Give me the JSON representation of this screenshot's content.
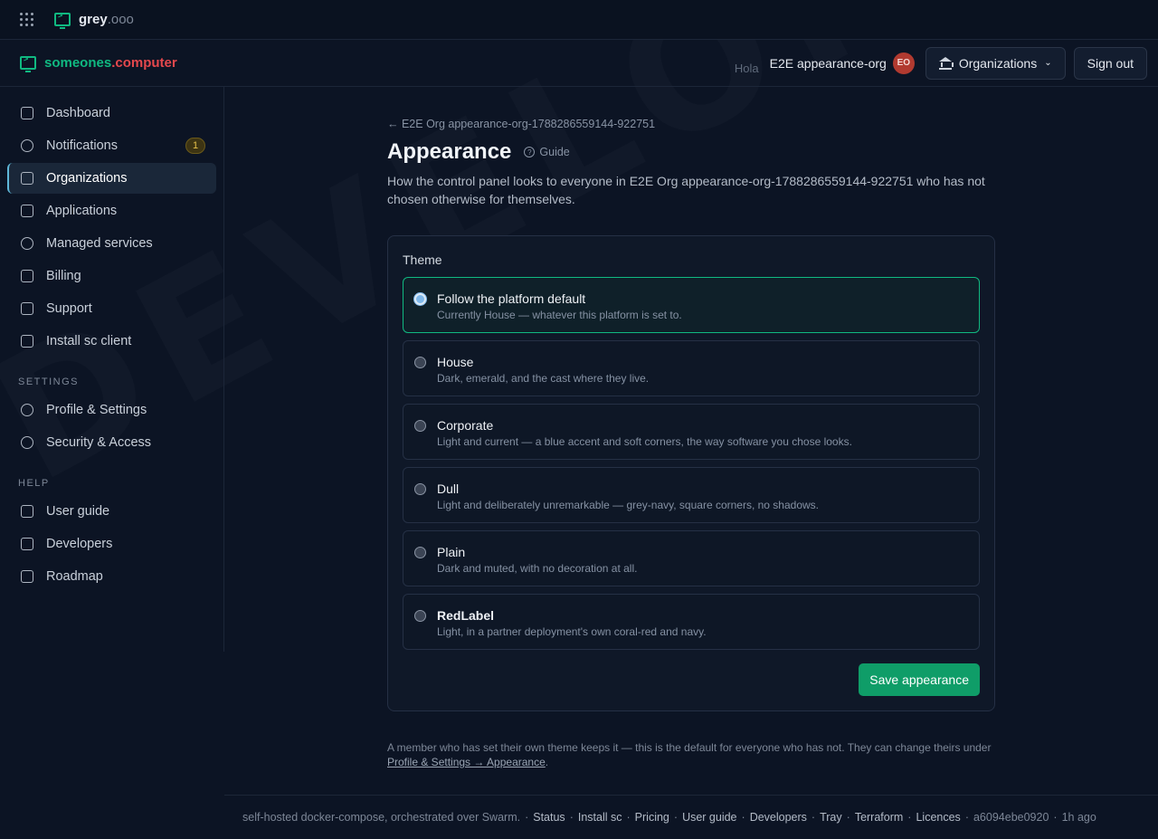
{
  "topbar": {
    "brand_name": "grey",
    "brand_tld": ".ooo"
  },
  "header": {
    "brand_a": "someones",
    "brand_b": ".computer",
    "greeting": "Hola",
    "org_name": "E2E appearance-org",
    "avatar_initials": "EO",
    "organizations_label": "Organizations",
    "sign_out_label": "Sign out"
  },
  "sidebar": {
    "items": [
      {
        "label": "Dashboard"
      },
      {
        "label": "Notifications",
        "badge": "1"
      },
      {
        "label": "Organizations"
      },
      {
        "label": "Applications"
      },
      {
        "label": "Managed services"
      },
      {
        "label": "Billing"
      },
      {
        "label": "Support"
      },
      {
        "label": "Install sc client"
      }
    ],
    "settings_heading": "SETTINGS",
    "settings_items": [
      {
        "label": "Profile & Settings"
      },
      {
        "label": "Security & Access"
      }
    ],
    "help_heading": "HELP",
    "help_items": [
      {
        "label": "User guide"
      },
      {
        "label": "Developers"
      },
      {
        "label": "Roadmap"
      }
    ]
  },
  "main": {
    "back_link": "← E2E Org appearance-org-1788286559144-922751",
    "title": "Appearance",
    "guide_label": "Guide",
    "description": "How the control panel looks to everyone in E2E Org appearance-org-1788286559144-922751 who has not chosen otherwise for themselves.",
    "theme_label": "Theme",
    "options": [
      {
        "title": "Follow the platform default",
        "subtitle": "Currently House — whatever this platform is set to."
      },
      {
        "title": "House",
        "subtitle": "Dark, emerald, and the cast where they live."
      },
      {
        "title": "Corporate",
        "subtitle": "Light and current — a blue accent and soft corners, the way software you chose looks."
      },
      {
        "title": "Dull",
        "subtitle": "Light and deliberately unremarkable — grey-navy, square corners, no shadows."
      },
      {
        "title": "Plain",
        "subtitle": "Dark and muted, with no decoration at all."
      },
      {
        "title": "RedLabel",
        "subtitle": "Light, in a partner deployment's own coral-red and navy."
      }
    ],
    "save_label": "Save appearance",
    "footnote_text": "A member who has set their own theme keeps it — this is the default for everyone who has not. They can change theirs under ",
    "footnote_link": "Profile & Settings → Appearance",
    "footnote_end": "."
  },
  "footer": {
    "prefix": "self-hosted docker-compose, orchestrated over Swarm.",
    "links": [
      "Status",
      "Install sc",
      "Pricing",
      "User guide",
      "Developers",
      "Tray",
      "Terraform",
      "Licences"
    ],
    "commit": "a6094ebe0920",
    "age": "1h ago"
  },
  "watermark": "DEVELOPMENT"
}
